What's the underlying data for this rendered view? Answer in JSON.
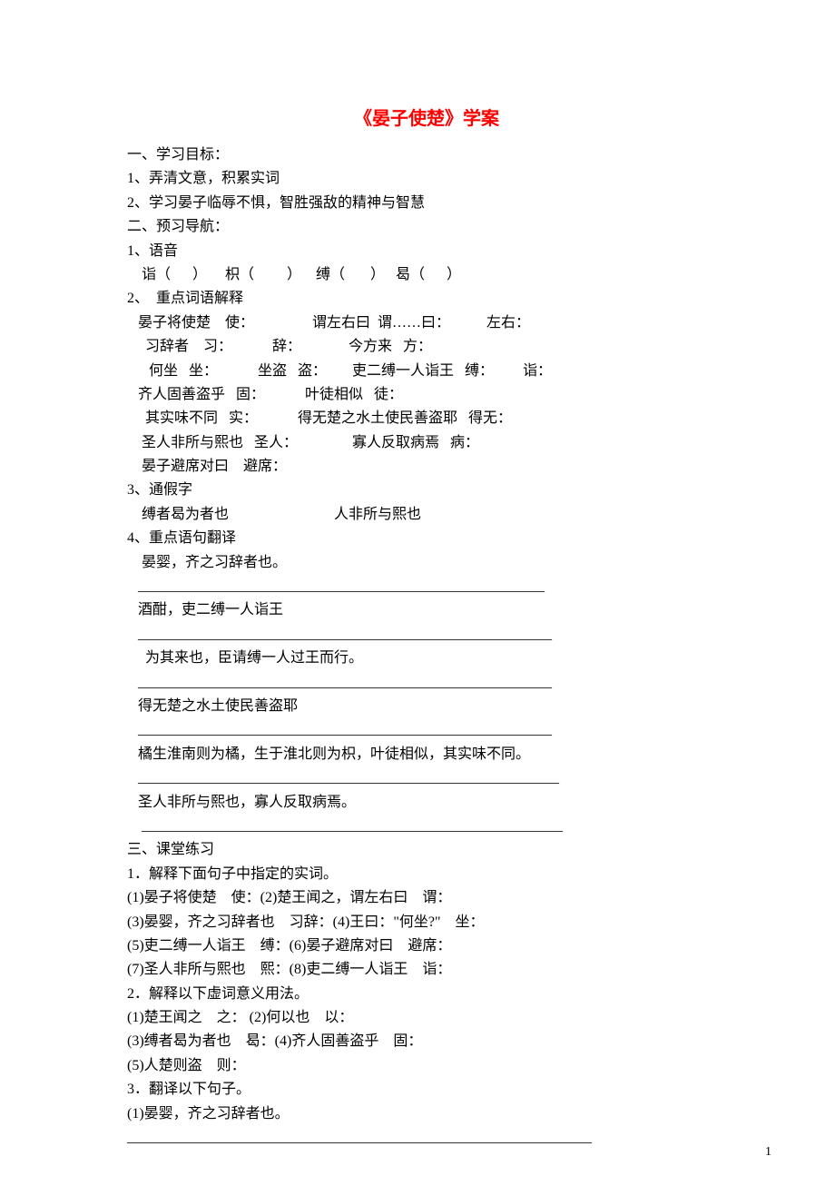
{
  "title": "《晏子使楚》学案",
  "sec1_h": "一、学习目标：",
  "sec1_1": "1、弄清文意，积累实词",
  "sec1_2": "2、学习晏子临辱不惧，智胜强敌的精神与智慧",
  "sec2_h": "二、预习导航：",
  "s2_1h": "1、语音",
  "s2_1a": "    诣（      ）     枳（         ）    缚（       ）   曷（      ）",
  "s2_2h": "2、  重点词语解释",
  "s2_2a": "   晏子将使楚    使：                谓左右曰  谓……曰：          左右：",
  "s2_2b": "     习辞者    习：           辞：             今方来   方：",
  "s2_2c": "      何坐   坐：           坐盗   盗：       吏二缚一人诣王   缚：        诣：",
  "s2_2d": "   齐人固善盗乎   固：           叶徒相似   徒：",
  "s2_2e": "     其实味不同   实：           得无楚之水土使民善盗耶   得无：",
  "s2_2f": "    圣人非所与熙也   圣人：               寡人反取病焉   病：",
  "s2_2g": "    晏子避席对曰    避席：",
  "s2_3h": "3、通假字",
  "s2_3a": "    缚者曷为者也                             人非所与熙也",
  "s2_4h": "4、重点语句翻译",
  "s2_4a": "    晏婴，齐之习辞者也。",
  "ul1": "   ________________________________________________________",
  "s2_4b": "   酒酣，吏二缚一人诣王",
  "ul2": "   _________________________________________________________",
  "s2_4c": "     为其来也，臣请缚一人过王而行。",
  "ul3": "   _________________________________________________________",
  "s2_4d": "   得无楚之水土使民善盗耶",
  "ul4": "   _________________________________________________________",
  "s2_4e": "   橘生淮南则为橘，生于淮北则为枳，叶徒相似，其实味不同。",
  "ul5": "   __________________________________________________________",
  "s2_4f": "   圣人非所与熙也，寡人反取病焉。",
  "ul6": "    __________________________________________________________",
  "sec3_h": "三、课堂练习",
  "s3_1h": "1．解释下面句子中指定的实词。",
  "s3_1a": "(1)晏子将使楚    使：(2)楚王闻之，谓左右曰    谓：",
  "s3_1b": "(3)晏婴，齐之习辞者也    习辞：(4)王曰：\"何坐?\"    坐：",
  "s3_1c": "(5)吏二缚一人诣王    缚：(6)晏子避席对曰    避席：",
  "s3_1d": "(7)圣人非所与熙也    熙：(8)吏二缚一人诣王    诣：",
  "s3_2h": "2．解释以下虚词意义用法。",
  "s3_2a": "(1)楚王闻之    之： (2)何以也    以：",
  "s3_2b": "(3)缚者曷为者也    曷：(4)齐人固善盗乎    固：",
  "s3_2c": "(5)人楚则盗    则：",
  "s3_3h": "3．翻译以下句子。",
  "s3_3a": "(1)晏婴，齐之习辞者也。",
  "ul7": "________________________________________________________________",
  "page_num": "1"
}
